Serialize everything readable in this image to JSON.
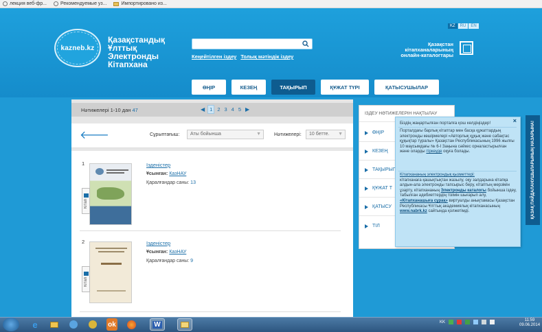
{
  "bookmarks": {
    "items": [
      {
        "icon": "page-icon",
        "label": "лекция веб-фр..."
      },
      {
        "icon": "chrome-icon",
        "label": "Рекомендуемые уз..."
      },
      {
        "icon": "folder-icon",
        "label": "Импортировано из..."
      }
    ]
  },
  "header": {
    "logo_text": "kazneb.kz",
    "title_lines": [
      "Қазақстандық",
      "Ұлттық",
      "Электронды",
      "Кітапхана"
    ],
    "search_placeholder": "",
    "search_links": [
      "Кеңейтілген іздеу",
      "Толық мәтіндік іздеу"
    ],
    "languages": [
      {
        "label": "KZ",
        "active": true
      },
      {
        "label": "RU",
        "active": false
      },
      {
        "label": "EN",
        "active": false
      }
    ],
    "catalogs_lines": [
      "Қазақстан",
      "кітапханаларының",
      "онлайн-каталогтары"
    ],
    "tabs": [
      {
        "label": "ӨҢІР",
        "active": false
      },
      {
        "label": "КЕЗЕҢ",
        "active": false
      },
      {
        "label": "ТАҚЫРЫП",
        "active": true
      },
      {
        "label": "ҚҰЖАТ ТҮРІ",
        "active": false
      },
      {
        "label": "ҚАТЫСУШЫЛАР",
        "active": false
      }
    ]
  },
  "results": {
    "summary_prefix": "Нәтижелері 1-10 дан ",
    "summary_total": "47",
    "pages": [
      "1",
      "2",
      "3",
      "4",
      "5"
    ],
    "current_page": "1",
    "sort_label": "Сұрыптағыш:",
    "sort_value": "Аты бойынша",
    "per_page_label": "Нәтижелері:",
    "per_page_value": "10 бетте.",
    "items": [
      {
        "number": "1",
        "title": "Ізденістер",
        "provided_label": "Ұсынған:",
        "provided_by": "КазНАУ",
        "views_label": "Қаралғандар саны:",
        "views": "13",
        "type_label": "Кітап"
      },
      {
        "number": "2",
        "title": "Ізденістер",
        "provided_label": "Ұсынған:",
        "provided_by": "КазНАУ",
        "views_label": "Қаралғандар саны:",
        "views": "9",
        "type_label": "Кітап"
      }
    ]
  },
  "facets": {
    "header": "ІЗДЕУ НӘТИЖЕЛЕРІН НАҚТЫЛАУ",
    "items": [
      "ӨҢІР",
      "КЕЗЕҢ",
      "ТАҚЫРЫП",
      "ҚҰЖАТ Т",
      "ҚАТЫСУ",
      "ТІЛ"
    ]
  },
  "popup": {
    "title": "Біздің жаңартылған порталға қош келдіңіздер!",
    "para1": "Порталдағы барлық кітаптар мен басқа құжаттардың электронды көшірмелері «Авторлық құқық және сабақтас құқықтар туралы» Қазақстан Республикасының 1996 жылғы 10 маусымдағы № 6-І Заңына сәйкес орналастырылған және оларды",
    "para1_link": "тіркеуде",
    "para1_end": " оқуға болады.",
    "para2_heading": "Кітапхананың электрондық қызметтері:",
    "para2": "кітапханаға қашықтықтан жазылу, оқу залдарына кітапқа алдын-ала электронды тапсырыс беру, кітаптың мерзімін ұзарту, кітапхананың ",
    "para2_link1": "Электронды каталогы",
    "para2_mid": " бойынша іздеу, табылған әдебиеттердің тізімін шығарып алу, ",
    "para2_link2": "«Кітапханашыға сұрақ»",
    "para2_mid2": " виртуалды анықтамасы Қазақстан Республикасы Ұлттық академиялық кітапханасының ",
    "para2_link3": "www.nabrk.kz",
    "para2_end": " сайтында қолжетімді.",
    "close": "×"
  },
  "side_tab": "ҚАЗАҚ ПАЙДАЛАНУШЫЛАРЫНЫҢ НАЗАРЫНА!",
  "taskbar": {
    "lang": "KK",
    "time": "11:59",
    "date": "09.06.2014"
  }
}
